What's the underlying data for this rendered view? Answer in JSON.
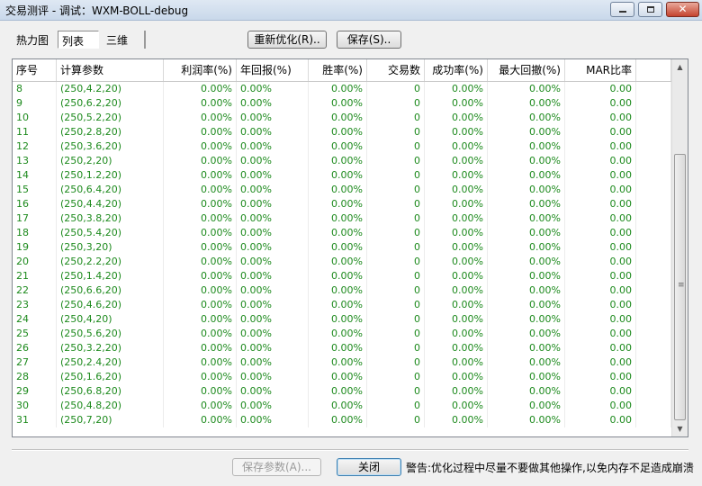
{
  "window": {
    "title": "交易测评 - 调试：WXM-BOLL-debug",
    "minimize_glyph": "",
    "maximize_glyph": "",
    "close_glyph": "✕"
  },
  "tabs": [
    {
      "label": "热力图"
    },
    {
      "label": "列表",
      "selected": true
    },
    {
      "label": "三维"
    }
  ],
  "toolbar": {
    "reoptimize_label": "重新优化(R)..",
    "save_label": "保存(S).."
  },
  "table": {
    "columns": [
      "序号",
      "计算参数",
      "利润率(%)",
      "年回报(%)",
      "胜率(%)",
      "交易数",
      "成功率(%)",
      "最大回撤(%)",
      "MAR比率"
    ],
    "rows": [
      [
        "8",
        "(250,4.2,20)",
        "0.00%",
        "0.00%",
        "0.00%",
        "0",
        "0.00%",
        "0.00%",
        "0.00"
      ],
      [
        "9",
        "(250,6.2,20)",
        "0.00%",
        "0.00%",
        "0.00%",
        "0",
        "0.00%",
        "0.00%",
        "0.00"
      ],
      [
        "10",
        "(250,5.2,20)",
        "0.00%",
        "0.00%",
        "0.00%",
        "0",
        "0.00%",
        "0.00%",
        "0.00"
      ],
      [
        "11",
        "(250,2.8,20)",
        "0.00%",
        "0.00%",
        "0.00%",
        "0",
        "0.00%",
        "0.00%",
        "0.00"
      ],
      [
        "12",
        "(250,3.6,20)",
        "0.00%",
        "0.00%",
        "0.00%",
        "0",
        "0.00%",
        "0.00%",
        "0.00"
      ],
      [
        "13",
        "(250,2,20)",
        "0.00%",
        "0.00%",
        "0.00%",
        "0",
        "0.00%",
        "0.00%",
        "0.00"
      ],
      [
        "14",
        "(250,1.2,20)",
        "0.00%",
        "0.00%",
        "0.00%",
        "0",
        "0.00%",
        "0.00%",
        "0.00"
      ],
      [
        "15",
        "(250,6.4,20)",
        "0.00%",
        "0.00%",
        "0.00%",
        "0",
        "0.00%",
        "0.00%",
        "0.00"
      ],
      [
        "16",
        "(250,4.4,20)",
        "0.00%",
        "0.00%",
        "0.00%",
        "0",
        "0.00%",
        "0.00%",
        "0.00"
      ],
      [
        "17",
        "(250,3.8,20)",
        "0.00%",
        "0.00%",
        "0.00%",
        "0",
        "0.00%",
        "0.00%",
        "0.00"
      ],
      [
        "18",
        "(250,5.4,20)",
        "0.00%",
        "0.00%",
        "0.00%",
        "0",
        "0.00%",
        "0.00%",
        "0.00"
      ],
      [
        "19",
        "(250,3,20)",
        "0.00%",
        "0.00%",
        "0.00%",
        "0",
        "0.00%",
        "0.00%",
        "0.00"
      ],
      [
        "20",
        "(250,2.2,20)",
        "0.00%",
        "0.00%",
        "0.00%",
        "0",
        "0.00%",
        "0.00%",
        "0.00"
      ],
      [
        "21",
        "(250,1.4,20)",
        "0.00%",
        "0.00%",
        "0.00%",
        "0",
        "0.00%",
        "0.00%",
        "0.00"
      ],
      [
        "22",
        "(250,6.6,20)",
        "0.00%",
        "0.00%",
        "0.00%",
        "0",
        "0.00%",
        "0.00%",
        "0.00"
      ],
      [
        "23",
        "(250,4.6,20)",
        "0.00%",
        "0.00%",
        "0.00%",
        "0",
        "0.00%",
        "0.00%",
        "0.00"
      ],
      [
        "24",
        "(250,4,20)",
        "0.00%",
        "0.00%",
        "0.00%",
        "0",
        "0.00%",
        "0.00%",
        "0.00"
      ],
      [
        "25",
        "(250,5.6,20)",
        "0.00%",
        "0.00%",
        "0.00%",
        "0",
        "0.00%",
        "0.00%",
        "0.00"
      ],
      [
        "26",
        "(250,3.2,20)",
        "0.00%",
        "0.00%",
        "0.00%",
        "0",
        "0.00%",
        "0.00%",
        "0.00"
      ],
      [
        "27",
        "(250,2.4,20)",
        "0.00%",
        "0.00%",
        "0.00%",
        "0",
        "0.00%",
        "0.00%",
        "0.00"
      ],
      [
        "28",
        "(250,1.6,20)",
        "0.00%",
        "0.00%",
        "0.00%",
        "0",
        "0.00%",
        "0.00%",
        "0.00"
      ],
      [
        "29",
        "(250,6.8,20)",
        "0.00%",
        "0.00%",
        "0.00%",
        "0",
        "0.00%",
        "0.00%",
        "0.00"
      ],
      [
        "30",
        "(250,4.8,20)",
        "0.00%",
        "0.00%",
        "0.00%",
        "0",
        "0.00%",
        "0.00%",
        "0.00"
      ],
      [
        "31",
        "(250,7,20)",
        "0.00%",
        "0.00%",
        "0.00%",
        "0",
        "0.00%",
        "0.00%",
        "0.00"
      ]
    ]
  },
  "scrollbar": {
    "up_glyph": "▲",
    "down_glyph": "▼",
    "grip_glyph": "≡"
  },
  "footer": {
    "save_params_label": "保存参数(A)...",
    "close_label": "关闭",
    "warning": "警告:优化过程中尽量不要做其他操作,以免内存不足造成崩溃"
  },
  "colors": {
    "value_text": "#1d8a1d"
  }
}
